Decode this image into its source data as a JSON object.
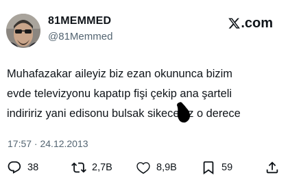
{
  "brand": {
    "text": "com",
    "icon": "x-logo-icon"
  },
  "author": {
    "name": "81MEMMED",
    "handle": "@81Memmed",
    "avatar_icon": "user-avatar"
  },
  "tweet": {
    "lines": [
      "Muhafazakar aileyiz biz ezan okununca bizim",
      "evde televizyonu kapatıp fişi çekip ana şarteli",
      "indiririz yani edisonu bulsak sikeceğiz o derece"
    ]
  },
  "timestamp": "17:57 · 24.12.2013",
  "actions": {
    "reply": {
      "count": "38",
      "icon": "reply-icon"
    },
    "retweet": {
      "count": "2,7B",
      "icon": "retweet-icon"
    },
    "like": {
      "count": "8,9B",
      "icon": "heart-icon"
    },
    "bookmark": {
      "count": "59",
      "icon": "bookmark-icon"
    },
    "share": {
      "icon": "share-icon"
    }
  },
  "colors": {
    "text_primary": "#0f1419",
    "text_secondary": "#536471",
    "background": "#ffffff"
  }
}
